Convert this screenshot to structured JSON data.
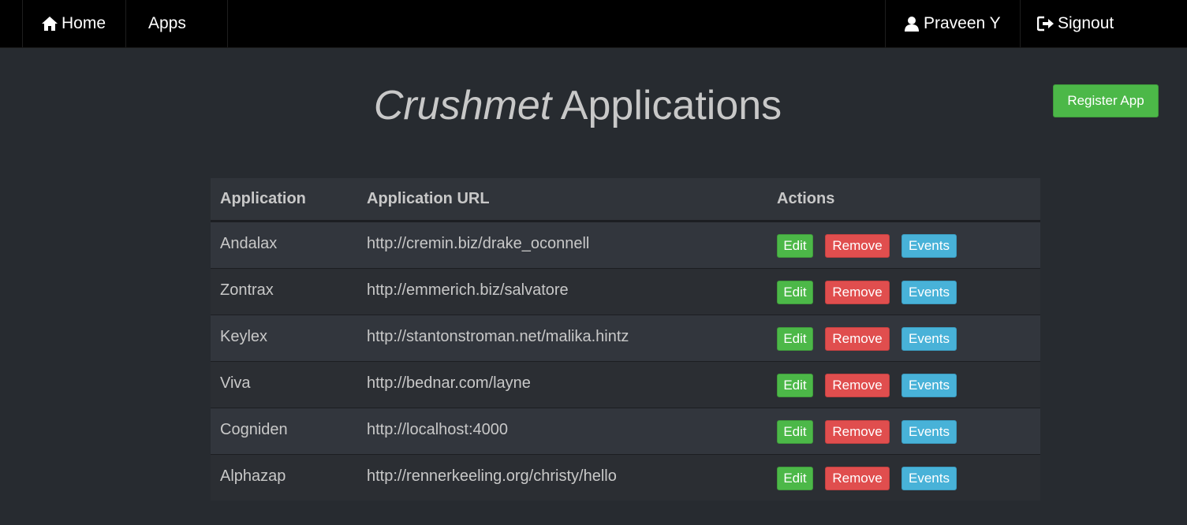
{
  "nav": {
    "home_label": "Home",
    "apps_label": "Apps",
    "user_label": "Praveen Y",
    "signout_label": "Signout",
    "icons": {
      "home": "home-icon",
      "user": "user-icon",
      "signout": "signout-icon"
    }
  },
  "header": {
    "title_brand": "Crushmet",
    "title_rest": "Applications",
    "register_label": "Register App"
  },
  "table": {
    "columns": [
      "Application",
      "Application URL",
      "Actions"
    ],
    "rows": [
      {
        "name": "Andalax",
        "url": "http://cremin.biz/drake_oconnell"
      },
      {
        "name": "Zontrax",
        "url": "http://emmerich.biz/salvatore"
      },
      {
        "name": "Keylex",
        "url": "http://stantonstroman.net/malika.hintz"
      },
      {
        "name": "Viva",
        "url": "http://bednar.com/layne"
      },
      {
        "name": "Cogniden",
        "url": "http://localhost:4000"
      },
      {
        "name": "Alphazap",
        "url": "http://rennerkeeling.org/christy/hello"
      }
    ],
    "actions": {
      "edit": "Edit",
      "remove": "Remove",
      "events": "Events"
    }
  },
  "colors": {
    "background": "#272b30",
    "navbar": "#000000",
    "success": "#4cb848",
    "danger": "#e04e4e",
    "info": "#48b2d8"
  }
}
